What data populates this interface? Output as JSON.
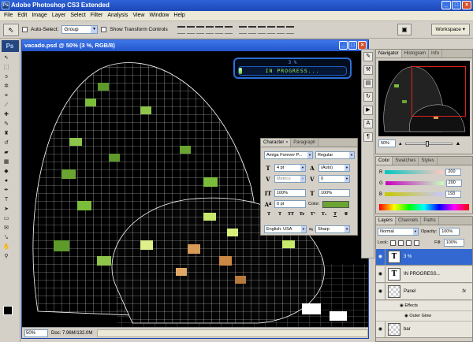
{
  "app": {
    "title": "Adobe Photoshop CS3 Extended",
    "ps_badge": "Ps"
  },
  "menu": [
    "File",
    "Edit",
    "Image",
    "Layer",
    "Select",
    "Filter",
    "Analysis",
    "View",
    "Window",
    "Help"
  ],
  "options": {
    "tool_glyph": "⇖",
    "auto_select_label": "Auto-Select:",
    "auto_select_value": "Group",
    "show_transform_label": "Show Transform Controls",
    "workspace_label": "Workspace ▾"
  },
  "document": {
    "title": "vacado.psd @ 50% (3 %, RGB/8)",
    "zoom": "50%",
    "doc_info": "Doc: 7.96M/132.0M"
  },
  "hud": {
    "percent_text": "3 %",
    "status_text": "IN PROGRESS...",
    "progress": 0.03
  },
  "character": {
    "tabs": [
      "Character",
      "Paragraph"
    ],
    "font_family": "Amiga Forever P...",
    "font_style": "Regular",
    "size": "4 pt",
    "leading": "(Auto)",
    "kerning": "Metrics",
    "tracking": "0",
    "vscale": "100%",
    "hscale": "100%",
    "baseline": "0 pt",
    "color_label": "Color:",
    "color": "#6aa431",
    "language": "English: USA",
    "antialias_label": "aₐ",
    "antialias": "Sharp",
    "style_buttons": [
      "T",
      "T",
      "TT",
      "Tr",
      "T¹",
      "T₁",
      "T",
      "T"
    ]
  },
  "navigator": {
    "tabs": [
      "Navigator",
      "Histogram",
      "Info"
    ],
    "zoom": "50%",
    "zoom_level": 0.45
  },
  "color_panel": {
    "tabs": [
      "Color",
      "Swatches",
      "Styles"
    ],
    "r_label": "R",
    "g_label": "G",
    "b_label": "B",
    "r": "200",
    "g": "200",
    "b": "193",
    "r_level": 0.784,
    "g_level": 0.784,
    "b_level": 0.757
  },
  "layers_panel": {
    "tabs": [
      "Layers",
      "Channels",
      "Paths"
    ],
    "blend_mode": "Normal",
    "opacity_label": "Opacity:",
    "opacity": "100%",
    "lock_label": "Lock:",
    "fill_label": "Fill:",
    "fill": "100%",
    "layers": [
      {
        "name": "3 %",
        "thumb": "T",
        "selected": true
      },
      {
        "name": "IN PROGRESS...",
        "thumb": "T",
        "selected": false
      },
      {
        "name": "Panel",
        "thumb": "",
        "selected": false,
        "fx": "fx"
      },
      {
        "name": "bar",
        "thumb": "",
        "selected": false
      }
    ],
    "effects_label": "Effects",
    "outer_glow_label": "Outer Glow"
  }
}
